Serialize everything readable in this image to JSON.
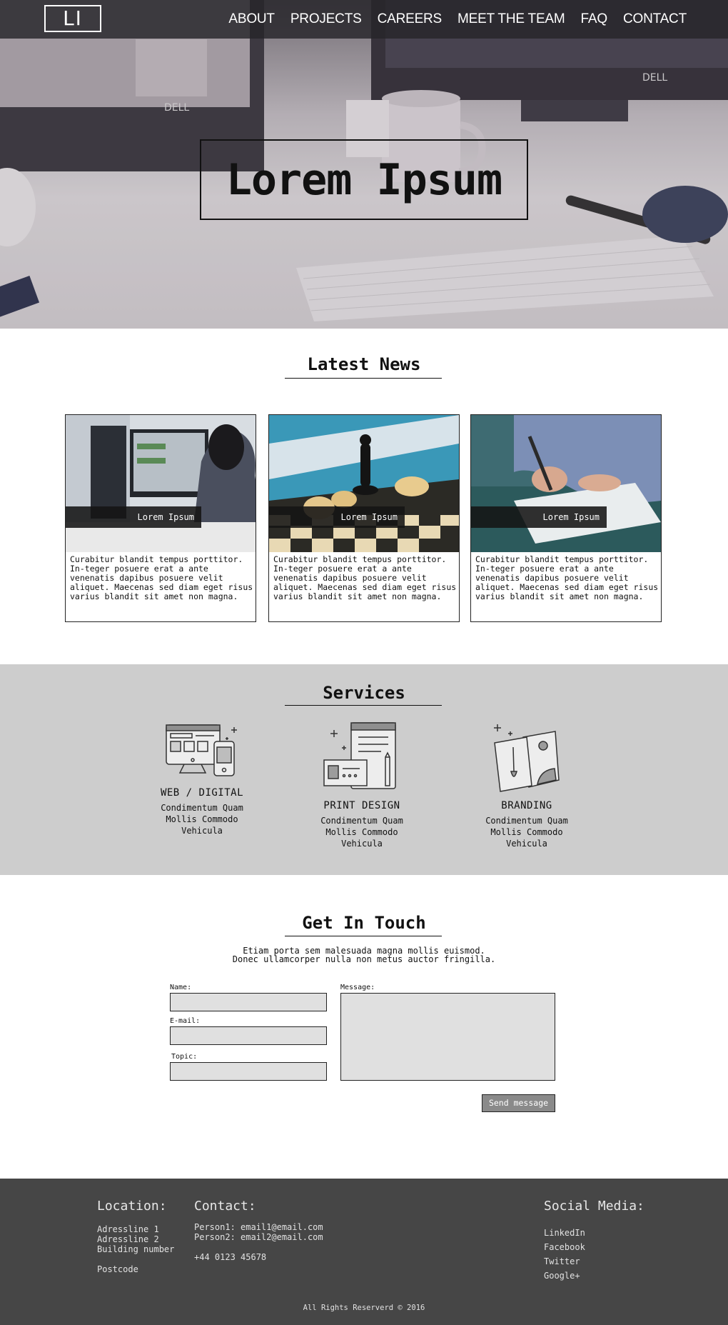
{
  "nav": {
    "logo": "LI",
    "items": [
      "ABOUT",
      "PROJECTS",
      "CAREERS",
      "MEET THE TEAM",
      "FAQ",
      "CONTACT"
    ]
  },
  "hero": {
    "title": "Lorem Ipsum"
  },
  "news": {
    "title": "Latest News",
    "cards": [
      {
        "label": "Lorem Ipsum",
        "text": "Curabitur blandit tempus porttitor. In-teger posuere erat a ante venenatis dapibus posuere velit aliquet. Maecenas sed diam eget risus varius blandit sit amet non magna."
      },
      {
        "label": "Lorem Ipsum",
        "text": "Curabitur blandit tempus porttitor. In-teger posuere erat a ante venenatis dapibus posuere velit aliquet. Maecenas sed diam eget risus varius blandit sit amet non magna."
      },
      {
        "label": "Lorem Ipsum",
        "text": "Curabitur blandit tempus porttitor. In-teger posuere erat a ante venenatis dapibus posuere velit aliquet. Maecenas sed diam eget risus varius blandit sit amet non magna."
      }
    ]
  },
  "services": {
    "title": "Services",
    "items": [
      {
        "icon": "web-digital-icon",
        "title": "WEB / DIGITAL",
        "desc1": "Condimentum Quam",
        "desc2": "Mollis Commodo",
        "desc3": "Vehicula"
      },
      {
        "icon": "print-design-icon",
        "title": "PRINT DESIGN",
        "desc1": "Condimentum Quam",
        "desc2": "Mollis Commodo",
        "desc3": "Vehicula"
      },
      {
        "icon": "branding-icon",
        "title": "BRANDING",
        "desc1": "Condimentum Quam",
        "desc2": "Mollis Commodo",
        "desc3": "Vehicula"
      }
    ]
  },
  "contact": {
    "title": "Get In Touch",
    "intro1": "Etiam porta sem malesuada magna mollis euismod.",
    "intro2": "Donec ullamcorper nulla non metus auctor fringilla.",
    "name_label": "Name:",
    "email_label": "E-mail:",
    "topic_label": "Topic:",
    "message_label": "Message:",
    "send_label": "Send message"
  },
  "footer": {
    "location_title": "Location:",
    "address1": "Adressline 1",
    "address2": "Adressline 2",
    "address3": "Building number",
    "postcode": "Postcode",
    "contact_title": "Contact:",
    "person1": "Person1: email1@email.com",
    "person2": "Person2: email2@email.com",
    "phone": "+44 0123 45678",
    "social_title": "Social Media:",
    "social": [
      "LinkedIn",
      "Facebook",
      "Twitter",
      "Google+"
    ],
    "copyright": "All Rights Reserverd © 2016"
  },
  "colors": {
    "nav_bg": "#26242a",
    "services_bg": "#cdcdcd",
    "footer_bg": "#464646",
    "field_bg": "#e0e0e0",
    "button_bg": "#8a8a8a"
  }
}
